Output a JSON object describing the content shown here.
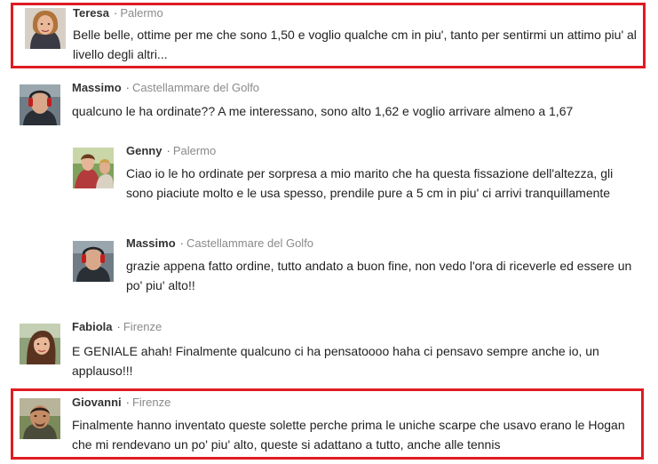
{
  "comments": [
    {
      "name": "Teresa",
      "city": "Palermo",
      "text": "Belle belle, ottime per me che sono 1,50 e voglio qualche cm in piu', tanto per sentirmi un attimo piu' al livello degli altri...",
      "highlighted": true
    },
    {
      "name": "Massimo",
      "city": "Castellammare del Golfo",
      "text": "qualcuno le ha ordinate?? A me interessano, sono alto 1,62 e voglio arrivare almeno a 1,67",
      "highlighted": false
    },
    {
      "name": "Genny",
      "city": "Palermo",
      "text": "Ciao io le ho ordinate per sorpresa a mio marito che ha questa fissazione dell'altezza, gli sono piaciute molto e le usa spesso, prendile pure a 5 cm in piu' ci arrivi tranquillamente",
      "highlighted": false
    },
    {
      "name": "Massimo",
      "city": "Castellammare del Golfo",
      "text": "grazie appena fatto ordine, tutto andato a buon fine, non vedo l'ora di riceverle ed essere un po' piu' alto!!",
      "highlighted": false
    },
    {
      "name": "Fabiola",
      "city": "Firenze",
      "text": "E GENIALE ahah! Finalmente qualcuno ci ha pensatoooo haha ci pensavo sempre anche io, un applauso!!!",
      "highlighted": false
    },
    {
      "name": "Giovanni",
      "city": "Firenze",
      "text": "Finalmente hanno inventato queste solette perche prima le uniche scarpe che usavo erano le Hogan che mi rendevano un po' piu' alto, queste si adattano a tutto, anche alle tennis",
      "highlighted": true
    }
  ],
  "colors": {
    "highlight_border": "#e01b22",
    "city_text": "#8a8a8a"
  }
}
